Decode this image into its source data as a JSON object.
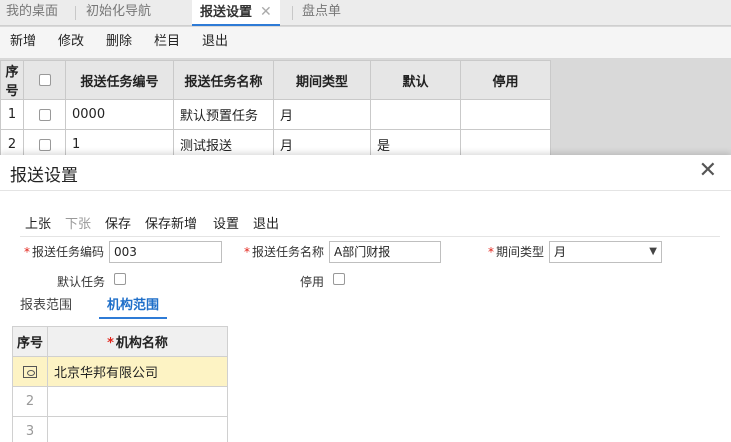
{
  "tabs": [
    {
      "label": "我的桌面"
    },
    {
      "label": "初始化导航"
    },
    {
      "label": "报送设置",
      "close": "✕"
    },
    {
      "label": "盘点单"
    }
  ],
  "toolbar": {
    "new": "新增",
    "edit": "修改",
    "delete": "删除",
    "columns": "栏目",
    "exit": "退出"
  },
  "grid": {
    "headers": [
      "序号",
      "",
      "报送任务编号",
      "报送任务名称",
      "期间类型",
      "默认",
      "停用"
    ],
    "rows": [
      {
        "seq": "1",
        "code": "0000",
        "name": "默认预置任务",
        "period": "月",
        "default": "",
        "disabled": ""
      },
      {
        "seq": "2",
        "code": "1",
        "name": "测试报送",
        "period": "月",
        "default": "是",
        "disabled": ""
      }
    ]
  },
  "dialog": {
    "title": "报送设置",
    "close": "✕",
    "toolbar": {
      "prev": "上张",
      "next": "下张",
      "save": "保存",
      "save_new": "保存新增",
      "settings": "设置",
      "exit": "退出"
    },
    "form": {
      "code_label": "报送任务编码",
      "code_value": "003",
      "name_label": "报送任务名称",
      "name_value": "A部门财报",
      "period_label": "期间类型",
      "period_value": "月",
      "default_label": "默认任务",
      "disabled_label": "停用"
    },
    "subtabs": {
      "report_scope": "报表范围",
      "org_scope": "机构范围"
    },
    "org_grid": {
      "headers": {
        "seq": "序号",
        "name": "机构名称"
      },
      "rows": [
        {
          "seq": "",
          "name": "北京华邦有限公司"
        },
        {
          "seq": "2",
          "name": ""
        },
        {
          "seq": "3",
          "name": ""
        }
      ]
    }
  },
  "colors": {
    "accent": "#2e7bd6",
    "required": "#e2231a",
    "selected_row": "#fdf3c4"
  }
}
